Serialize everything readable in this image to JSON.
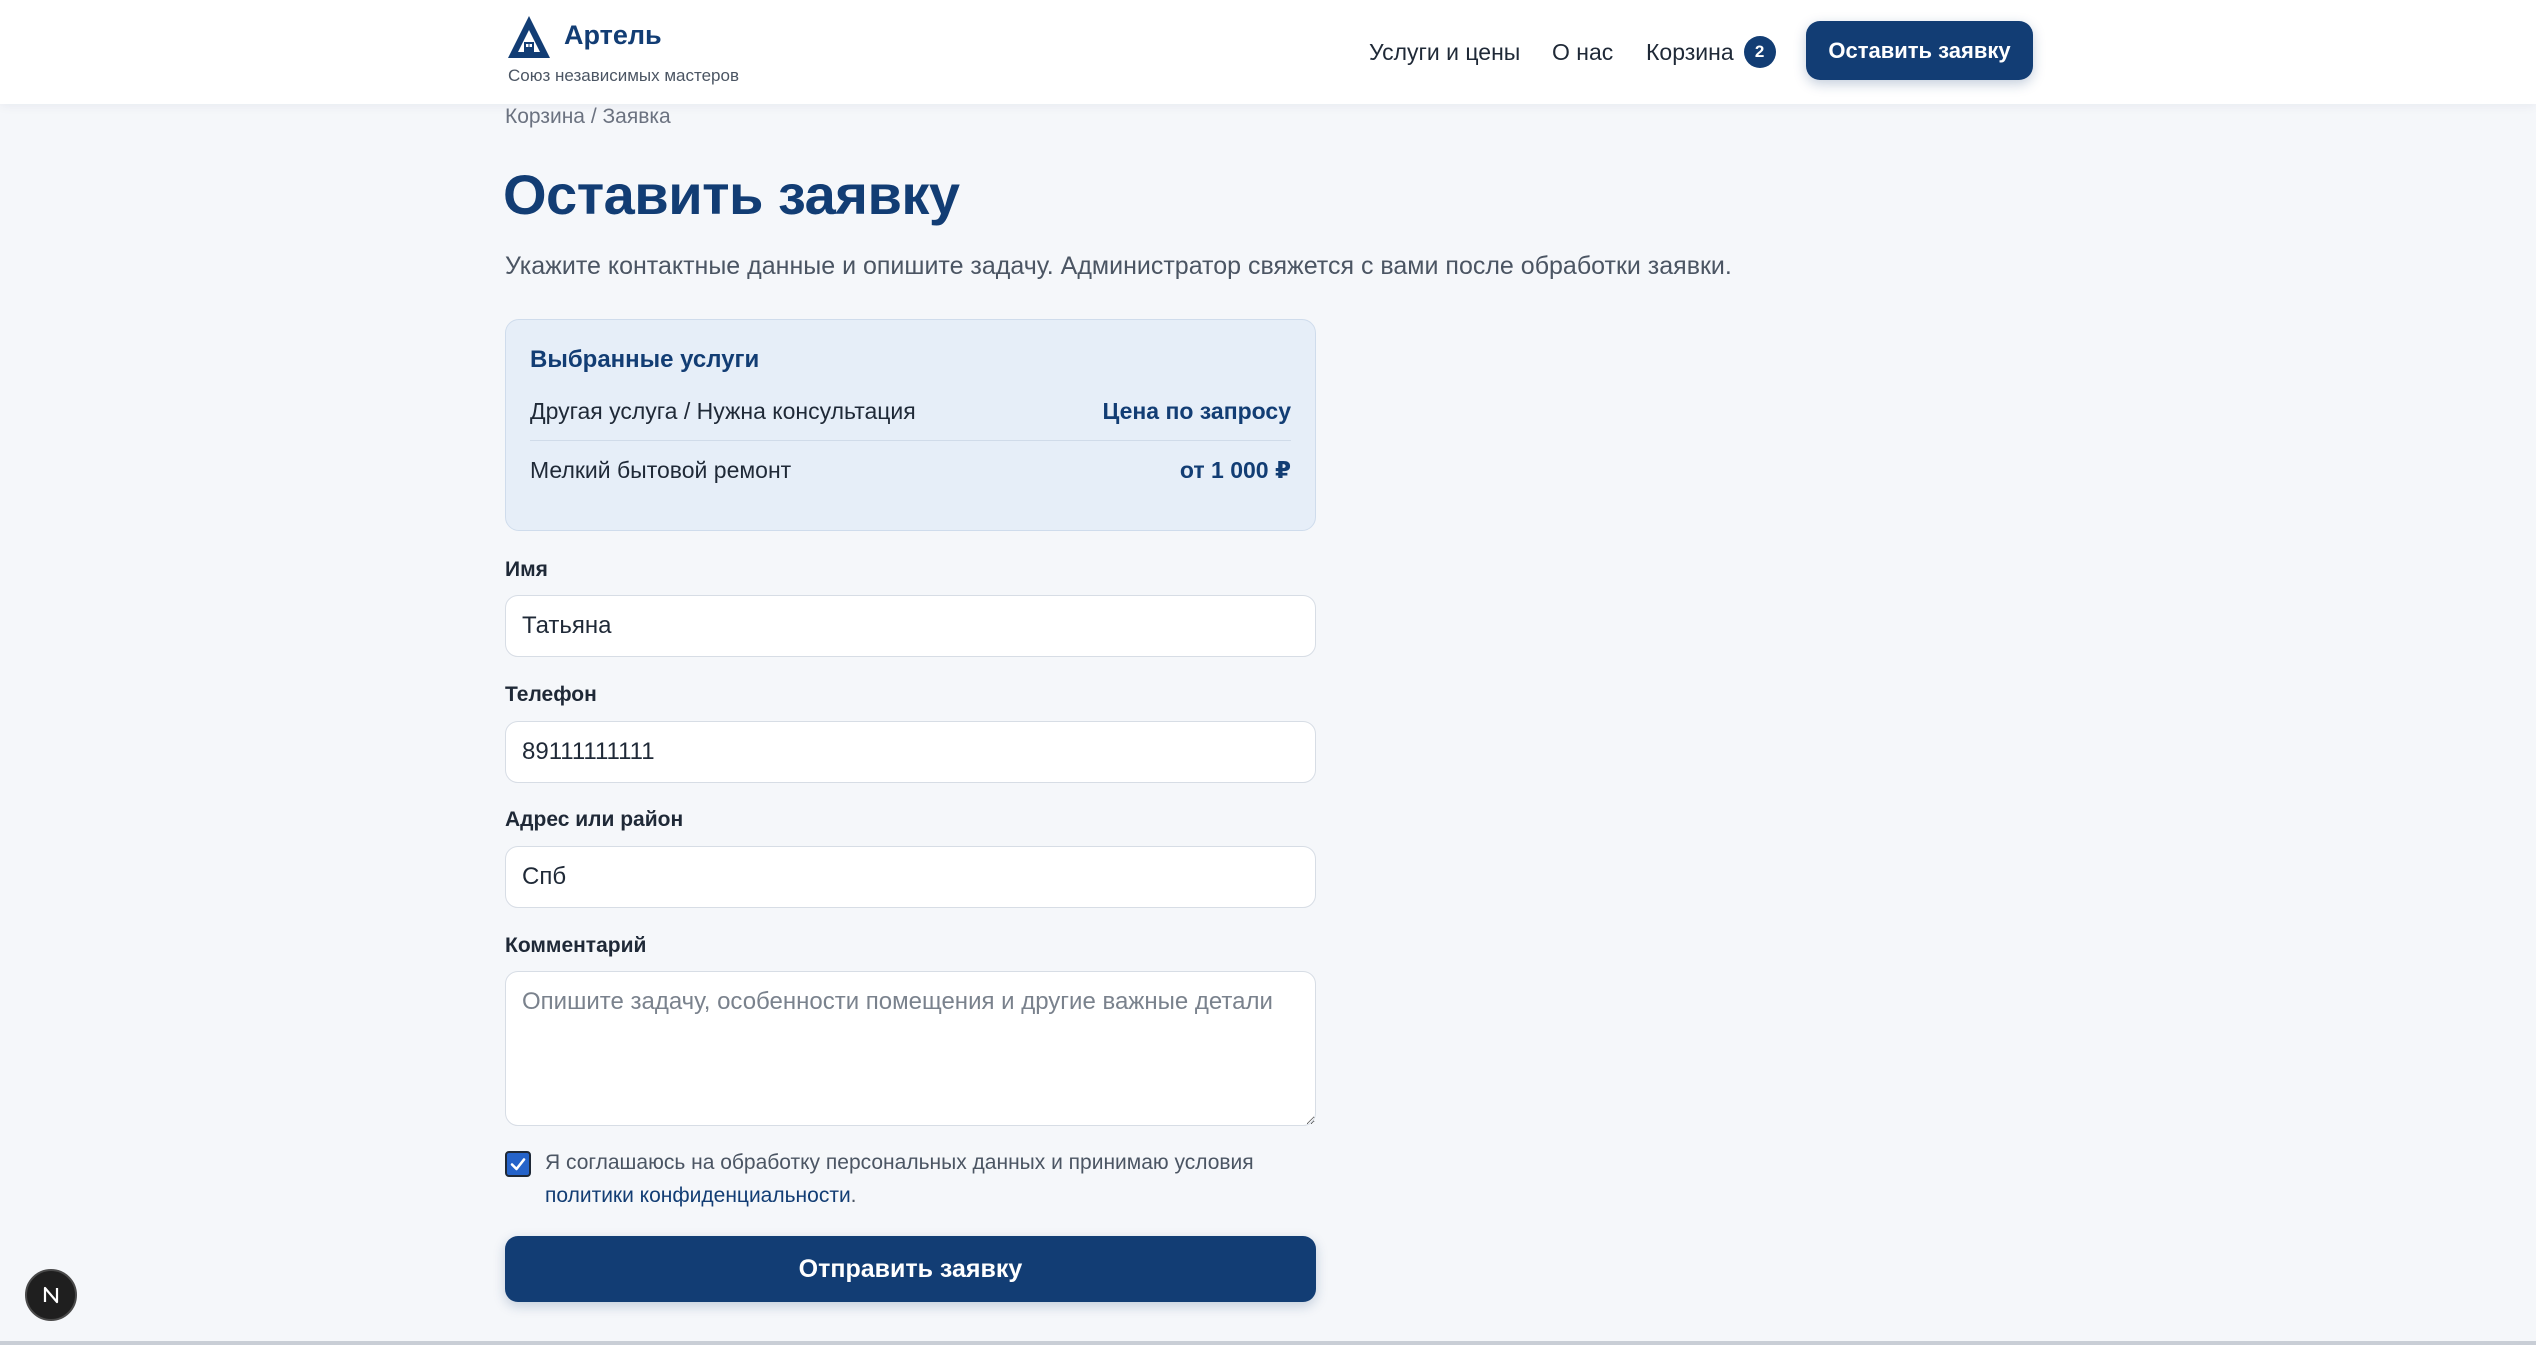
{
  "header": {
    "brand_name": "Артель",
    "brand_tagline": "Союз независимых мастеров",
    "nav": {
      "services": "Услуги и цены",
      "about": "О нас",
      "cart": "Корзина",
      "cart_count": "2"
    },
    "cta_label": "Оставить заявку"
  },
  "breadcrumb": "Корзина / Заявка",
  "page": {
    "title": "Оставить заявку",
    "subtitle": "Укажите контактные данные и опишите задачу. Администратор свяжется с вами после обработки заявки."
  },
  "services": {
    "title": "Выбранные услуги",
    "items": [
      {
        "name": "Другая услуга / Нужна консультация",
        "price": "Цена по запросу"
      },
      {
        "name": "Мелкий бытовой ремонт",
        "price": "от 1 000 ₽"
      }
    ]
  },
  "form": {
    "name": {
      "label": "Имя",
      "value": "Татьяна"
    },
    "phone": {
      "label": "Телефон",
      "value": "89111111111"
    },
    "address": {
      "label": "Адрес или район",
      "value": "Спб"
    },
    "comment": {
      "label": "Комментарий",
      "placeholder": "Опишите задачу, особенности помещения и другие важные детали"
    },
    "consent": {
      "checked": true,
      "text_before": "Я соглашаюсь на обработку персональных данных и принимаю условия ",
      "link_text": "политики конфиденциальности",
      "text_after": "."
    },
    "submit_label": "Отправить заявку"
  },
  "colors": {
    "brand": "#123d74",
    "background": "#f5f7fa",
    "services_bg": "#e6eef8"
  },
  "icons": {
    "logo": "triangle-house-logo-icon",
    "checkbox": "checkmark-icon",
    "dev_badge": "n-letter-icon"
  }
}
